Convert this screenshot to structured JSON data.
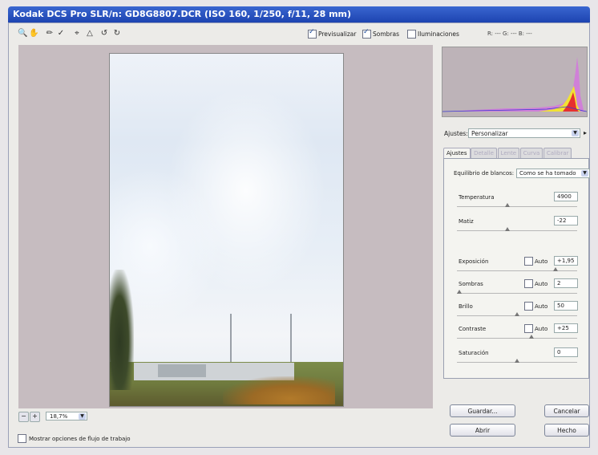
{
  "window": {
    "title": "Kodak DCS Pro SLR/n:  GD8G8807.DCR  (ISO 160, 1/250, f/11, 28 mm)"
  },
  "toolbar": {
    "tools": [
      "zoom-icon",
      "hand-icon",
      "eyedropper-icon",
      "color-sampler-icon",
      "crop-icon",
      "straighten-icon",
      "rotate-left-icon",
      "rotate-right-icon"
    ],
    "previsualizar": {
      "label": "Previsualizar",
      "checked": true
    },
    "sombras": {
      "label": "Sombras",
      "checked": true
    },
    "iluminaciones": {
      "label": "Iluminaciones",
      "checked": false
    },
    "rgb_readout": "R: ---  G: ---  B: ---"
  },
  "zoom": {
    "minus": "−",
    "plus": "+",
    "value": "18,7%"
  },
  "workflow": {
    "label": "Mostrar opciones de flujo de trabajo",
    "checked": false
  },
  "settings": {
    "label": "Ajustes:",
    "value": "Personalizar"
  },
  "tabs": [
    {
      "label": "Ajustes",
      "active": true
    },
    {
      "label": "Detalle",
      "active": false
    },
    {
      "label": "Lente",
      "active": false
    },
    {
      "label": "Curva",
      "active": false
    },
    {
      "label": "Calibrar",
      "active": false
    }
  ],
  "white_balance": {
    "label": "Equilibrio de blancos:",
    "value": "Como se ha tomado"
  },
  "params": [
    {
      "name": "Temperatura",
      "value": "4900",
      "auto": null,
      "slider": 0.42
    },
    {
      "name": "Matiz",
      "value": "-22",
      "auto": null,
      "slider": 0.42
    },
    {
      "name": "Exposición",
      "value": "+1,95",
      "auto": "Auto",
      "slider": 0.82
    },
    {
      "name": "Sombras",
      "value": "2",
      "auto": "Auto",
      "slider": 0.02
    },
    {
      "name": "Brillo",
      "value": "50",
      "auto": "Auto",
      "slider": 0.5
    },
    {
      "name": "Contraste",
      "value": "+25",
      "auto": "Auto",
      "slider": 0.62
    },
    {
      "name": "Saturación",
      "value": "0",
      "auto": null,
      "slider": 0.5
    }
  ],
  "buttons": {
    "guardar": "Guardar...",
    "cancelar": "Cancelar",
    "abrir": "Abrir",
    "hecho": "Hecho"
  },
  "colors": {
    "titlebar": "#2350c0",
    "preview_bg": "#c6bcc0"
  }
}
